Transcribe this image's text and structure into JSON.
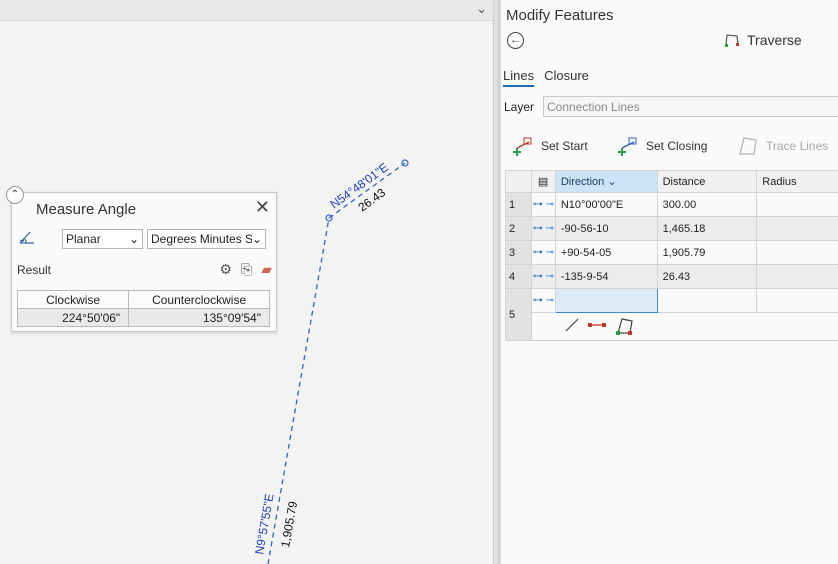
{
  "map": {
    "label_upper_bearing": "N54°48'01\"E",
    "label_upper_distance": "26.43",
    "label_lower_bearing": "N9°57'55\"E",
    "label_lower_distance": "1,905.79"
  },
  "measure_angle": {
    "title": "Measure Angle",
    "mode": "Planar",
    "unit": "Degrees Minutes S",
    "result_label": "Result",
    "columns": [
      "Clockwise",
      "Counterclockwise"
    ],
    "clockwise": "224°50'06\"",
    "counterclockwise": "135°09'54\""
  },
  "panel": {
    "title": "Modify Features",
    "tool_name": "Traverse",
    "tabs": [
      "Lines",
      "Closure"
    ],
    "layer_label": "Layer",
    "layer_value": "Connection Lines",
    "set_start": "Set Start",
    "set_closing": "Set Closing",
    "trace_lines": "Trace Lines"
  },
  "grid": {
    "headers": [
      "Direction",
      "Distance",
      "Radius"
    ],
    "rows": [
      {
        "n": "1",
        "direction": "N10°00'00\"E",
        "distance": "300.00"
      },
      {
        "n": "2",
        "direction": "-90-56-10",
        "distance": "1,465.18"
      },
      {
        "n": "3",
        "direction": "+90-54-05",
        "distance": "1,905.79"
      },
      {
        "n": "4",
        "direction": "-135-9-54",
        "distance": "26.43"
      },
      {
        "n": "5",
        "direction": "",
        "distance": ""
      }
    ]
  },
  "colors": {
    "accent": "#1c6bb5",
    "line": "#2f64c9"
  }
}
